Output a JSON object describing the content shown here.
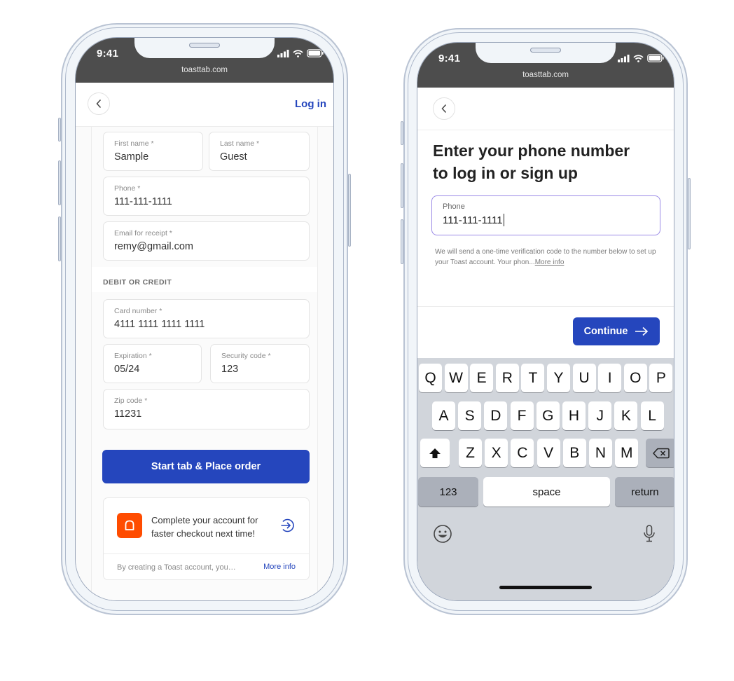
{
  "colors": {
    "brand_blue": "#2546bd",
    "toast_orange": "#ff4c00",
    "status_bar": "#4d4d4d",
    "focus_border": "#9b8be6"
  },
  "checkout_phone": {
    "status_bar": {
      "time": "9:41",
      "url": "toasttab.com",
      "icons": [
        "signal-icon",
        "wifi-icon",
        "battery-icon"
      ]
    },
    "nav": {
      "back_icon": "chevron-left-icon",
      "login_label": "Log in"
    },
    "fields": {
      "first_name": {
        "label": "First name *",
        "value": "Sample"
      },
      "last_name": {
        "label": "Last name *",
        "value": "Guest"
      },
      "phone": {
        "label": "Phone *",
        "value": "111-111-1111"
      },
      "email": {
        "label": "Email for receipt *",
        "value": "remy@gmail.com"
      },
      "card_number": {
        "label": "Card number *",
        "value": "4111 1111 1111 1111"
      },
      "expiration": {
        "label": "Expiration *",
        "value": "05/24"
      },
      "security_code": {
        "label": "Security code *",
        "value": "123"
      },
      "zip_code": {
        "label": "Zip code *",
        "value": "11231"
      }
    },
    "payment_section_title": "DEBIT OR CREDIT",
    "submit_label": "Start tab & Place order",
    "promo": {
      "logo_icon": "toast-logo-icon",
      "text": "Complete your account for faster checkout next time!",
      "arrow_icon": "arrow-right-circle-icon",
      "footer_text": "By creating a Toast account, you…",
      "more_info": "More info"
    }
  },
  "login_phone": {
    "status_bar": {
      "time": "9:41",
      "url": "toasttab.com",
      "icons": [
        "signal-icon",
        "wifi-icon",
        "battery-icon"
      ]
    },
    "nav": {
      "back_icon": "chevron-left-icon"
    },
    "heading_line1": "Enter your phone number",
    "heading_line2": "to log in or sign up",
    "phone_field": {
      "label": "Phone",
      "value": "111-111-1111"
    },
    "helper_text": "We will send a one-time verification code to the number below to set up your Toast account. Your phon...",
    "helper_more": "More info",
    "continue_label": "Continue",
    "keyboard": {
      "row1": [
        "Q",
        "W",
        "E",
        "R",
        "T",
        "Y",
        "U",
        "I",
        "O",
        "P"
      ],
      "row2": [
        "A",
        "S",
        "D",
        "F",
        "G",
        "H",
        "J",
        "K",
        "L"
      ],
      "row3": [
        "Z",
        "X",
        "C",
        "V",
        "B",
        "N",
        "M"
      ],
      "numbers_key": "123",
      "space_key": "space",
      "return_key": "return",
      "shift_icon": "shift-icon",
      "delete_icon": "backspace-icon",
      "emoji_icon": "emoji-icon",
      "mic_icon": "microphone-icon"
    }
  }
}
